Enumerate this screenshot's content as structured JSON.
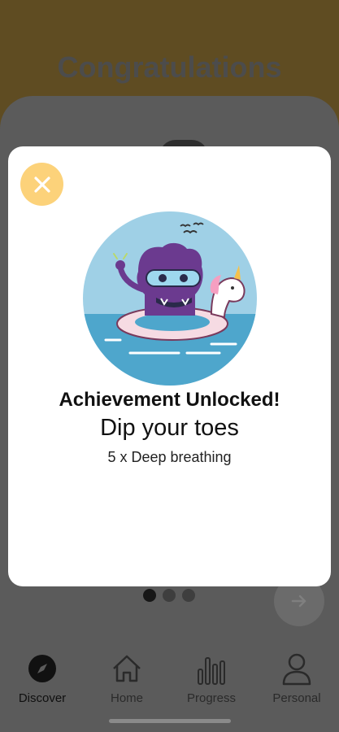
{
  "background": {
    "title": "Congratulations"
  },
  "modal": {
    "achievement_title": "Achievement Unlocked!",
    "achievement_name": "Dip your toes",
    "achievement_description": "5 x Deep breathing",
    "close_icon": "close-icon",
    "badge_illustration": "purple-monster-on-unicorn-float"
  },
  "pager": {
    "total": 3,
    "active_index": 0
  },
  "next_icon": "arrow-right-icon",
  "tabbar": {
    "tabs": [
      {
        "label": "Discover",
        "icon": "compass-icon",
        "active": true
      },
      {
        "label": "Home",
        "icon": "home-icon",
        "active": false
      },
      {
        "label": "Progress",
        "icon": "bar-chart-icon",
        "active": false
      },
      {
        "label": "Personal",
        "icon": "person-icon",
        "active": false
      }
    ]
  },
  "colors": {
    "close_button": "#fcd27a",
    "badge_background": "#9fd0e6",
    "monster": "#6b3a8f"
  }
}
